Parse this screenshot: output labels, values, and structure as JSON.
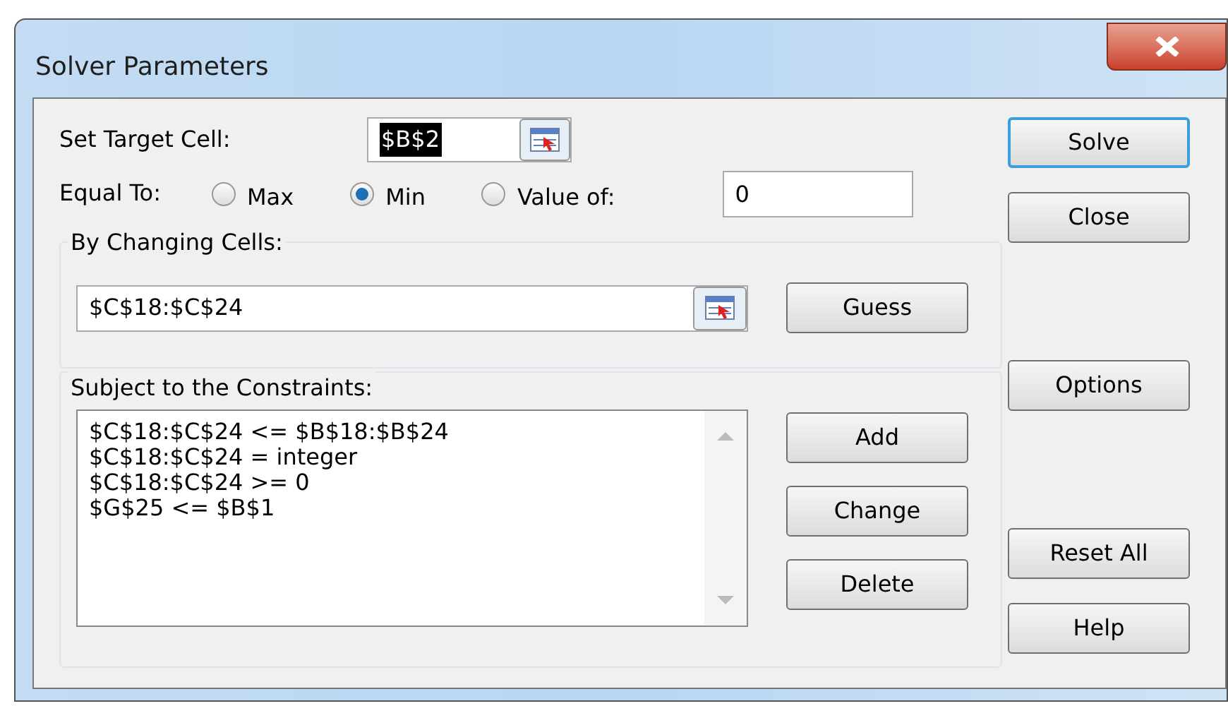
{
  "window": {
    "title": "Solver Parameters"
  },
  "target_cell": {
    "label": "Set Target Cell:",
    "value": "$B$2"
  },
  "equal_to": {
    "label": "Equal To:",
    "options": [
      {
        "label": "Max",
        "selected": false
      },
      {
        "label": "Min",
        "selected": true
      },
      {
        "label": "Value of:",
        "selected": false
      }
    ],
    "value": "0"
  },
  "changing_cells": {
    "label": "By Changing Cells:",
    "value": "$C$18:$C$24",
    "button": "Guess"
  },
  "constraints": {
    "label": "Subject to the Constraints:",
    "items": [
      "$C$18:$C$24 <= $B$18:$B$24",
      "$C$18:$C$24 = integer",
      "$C$18:$C$24 >= 0",
      "$G$25 <= $B$1"
    ],
    "buttons": [
      "Add",
      "Change",
      "Delete"
    ]
  },
  "side_buttons": [
    {
      "label": "Solve",
      "selected": true
    },
    {
      "label": "Close",
      "selected": false
    },
    {
      "label": "Options",
      "selected": false
    },
    {
      "label": "Reset All",
      "selected": false
    },
    {
      "label": "Help",
      "selected": false
    }
  ]
}
